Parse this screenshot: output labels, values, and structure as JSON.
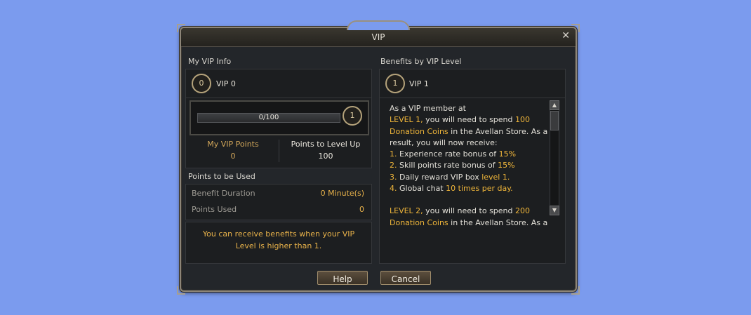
{
  "window": {
    "title": "VIP",
    "close_label": "✕"
  },
  "left": {
    "section_title": "My VIP Info",
    "current_vip_badge": "0",
    "current_vip_label": "VIP 0",
    "progress_text": "0/100",
    "progress_fraction": 0.0,
    "next_badge": "1",
    "stats": {
      "my_points_label": "My VIP Points",
      "my_points_value": "0",
      "to_level_label": "Points to Level Up",
      "to_level_value": "100"
    },
    "points_section_title": "Points to be Used",
    "benefit_duration_label": "Benefit Duration",
    "benefit_duration_value": "0 Minute(s)",
    "points_used_label": "Points Used",
    "points_used_value": "0",
    "notice": "You can receive benefits when your VIP Level is higher than 1."
  },
  "right": {
    "section_title": "Benefits by VIP Level",
    "vip_badge": "1",
    "vip_label": "VIP 1",
    "text": {
      "intro": "As a VIP member at",
      "l1_level": "LEVEL 1,",
      "l1_spend": " you will need to spend ",
      "l1_amount": "100",
      "l1_coins": "Donation Coins",
      "l1_store": " in the Avellan Store. As a result, you will now receive:",
      "b1_num": "1.",
      "b1_text": " Experience rate bonus of ",
      "b1_val": "15%",
      "b2_num": "2.",
      "b2_text": " Skill points rate bonus of ",
      "b2_val": "15%",
      "b3_num": "3.",
      "b3_text": " Daily reward VIP box ",
      "b3_val": "level 1.",
      "b4_num": "4.",
      "b4_text": " Global chat ",
      "b4_val": "10 times per day.",
      "l2_level": "LEVEL 2,",
      "l2_spend": " you will need to spend ",
      "l2_amount": "200",
      "l2_coins": "Donation Coins",
      "l2_store": " in the Avellan Store. As a"
    }
  },
  "buttons": {
    "help": "Help",
    "cancel": "Cancel"
  },
  "colors": {
    "accent": "#f0b63a",
    "background": "#7b9bee",
    "window": "#23262a"
  }
}
